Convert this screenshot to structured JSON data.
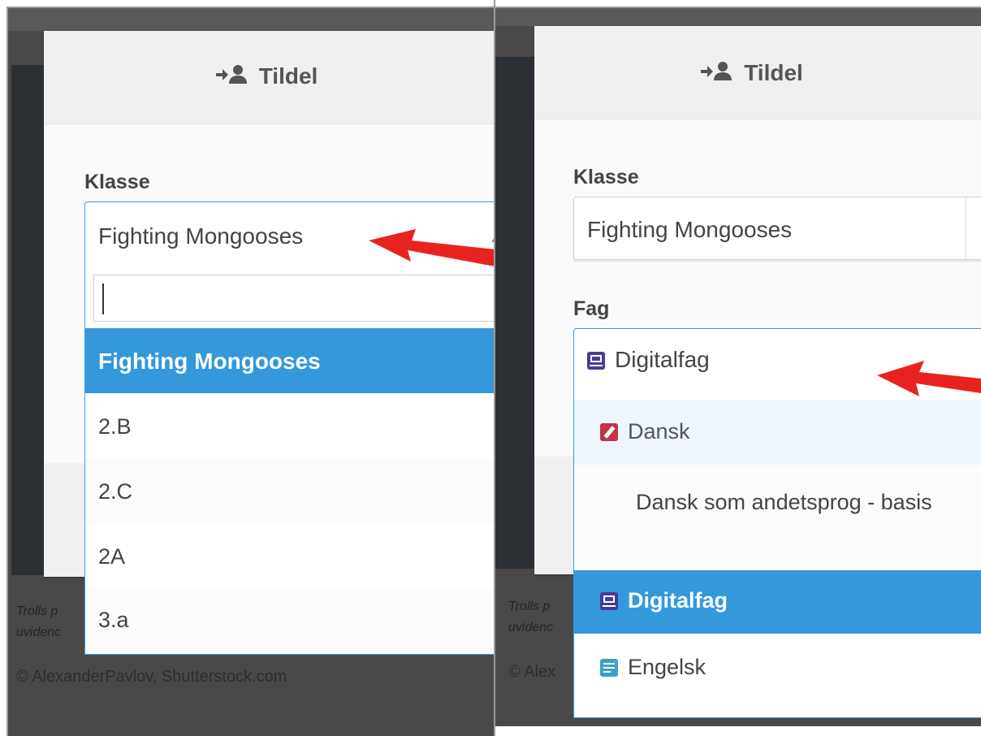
{
  "left": {
    "modal_title": "Tildel",
    "klasse_label": "Klasse",
    "selected_value": "Fighting Mongooses",
    "search_value": "",
    "options": [
      "Fighting Mongooses",
      "2.B",
      "2.C",
      "2A",
      "3.a"
    ],
    "caption": "Trolls p\nuvidenc",
    "credit": "© AlexanderPavlov, Shutterstock.com"
  },
  "right": {
    "modal_title": "Tildel",
    "klasse_label": "Klasse",
    "klasse_value": "Fighting Mongooses",
    "fag_label": "Fag",
    "fag_value": "Digitalfag",
    "options": [
      {
        "label": "Dansk",
        "icon": "pencil-icon"
      },
      {
        "label": "Dansk som andetsprog - basis",
        "icon": ""
      },
      {
        "label": "Digitalfag",
        "icon": "laptop-icon"
      },
      {
        "label": "Engelsk",
        "icon": "speech-icon"
      }
    ],
    "caption": "Trolls p\nuvidenc",
    "credit": "© Alex"
  },
  "colors": {
    "accent": "#3498db",
    "pencil_icon": "#c0334a",
    "laptop_icon": "#4a3b8f",
    "speech_icon": "#3aa3c2",
    "arrow": "#e8231f"
  }
}
